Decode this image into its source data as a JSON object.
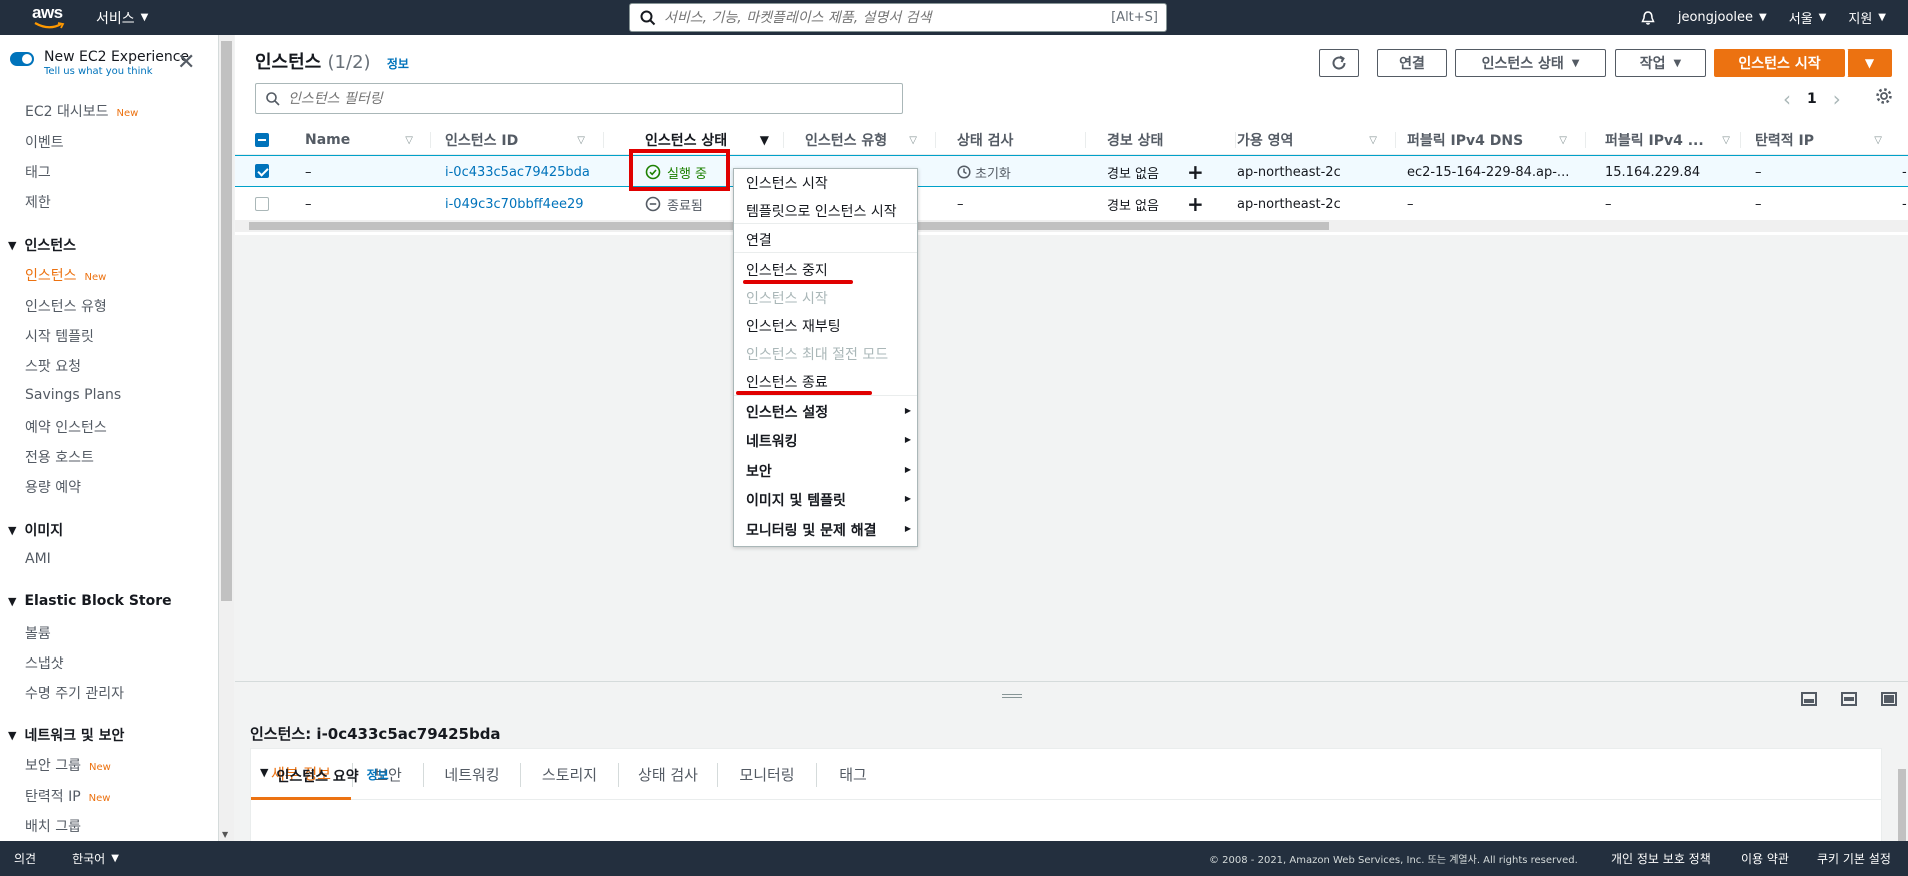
{
  "topnav": {
    "logo": "aws",
    "services_label": "서비스",
    "search_placeholder": "서비스, 기능, 마켓플레이스 제품, 설명서 검색",
    "search_shortcut": "[Alt+S]",
    "user": "jeongjoolee",
    "region": "서울",
    "support": "지원"
  },
  "sidebar": {
    "experience_title": "New EC2 Experience",
    "experience_sub": "Tell us what you think",
    "items_top": [
      "EC2 대시보드",
      "이벤트",
      "태그",
      "제한"
    ],
    "new_badge": "New",
    "section_instances": "인스턴스",
    "items_instances": [
      "인스턴스",
      "인스턴스 유형",
      "시작 템플릿",
      "스팟 요청",
      "Savings Plans",
      "예약 인스턴스",
      "전용 호스트",
      "용량 예약"
    ],
    "section_images": "이미지",
    "items_images": [
      "AMI"
    ],
    "section_ebs": "Elastic Block Store",
    "items_ebs": [
      "볼륨",
      "스냅샷",
      "수명 주기 관리자"
    ],
    "section_network": "네트워크 및 보안",
    "items_network": [
      "보안 그룹",
      "탄력적 IP",
      "배치 그룹"
    ]
  },
  "main": {
    "title": "인스턴스",
    "count": "(1/2)",
    "info": "정보",
    "btn_connect": "연결",
    "btn_state": "인스턴스 상태",
    "btn_actions": "작업",
    "btn_launch": "인스턴스 시작",
    "filter_placeholder": "인스턴스 필터링",
    "page": "1"
  },
  "table": {
    "columns": [
      "Name",
      "인스턴스 ID",
      "인스턴스 상태",
      "인스턴스 유형",
      "상태 검사",
      "경보 상태",
      "가용 영역",
      "퍼블릭 IPv4 DNS",
      "퍼블릭 IPv4 ...",
      "탄력적 IP"
    ],
    "rows": [
      {
        "name": "–",
        "id": "i-0c433c5ac79425bda",
        "state": "실행 중",
        "type": "",
        "check": "초기화",
        "alarm": "경보 없음",
        "az": "ap-northeast-2c",
        "dns": "ec2-15-164-229-84.ap-...",
        "ip": "15.164.229.84",
        "eip": "–",
        "extra": "-"
      },
      {
        "name": "–",
        "id": "i-049c3c70bbff4ee29",
        "state": "종료됨",
        "type": "",
        "check": "–",
        "alarm": "경보 없음",
        "az": "ap-northeast-2c",
        "dns": "–",
        "ip": "–",
        "eip": "–",
        "extra": "-"
      }
    ]
  },
  "context_menu": {
    "items": [
      "인스턴스 시작",
      "템플릿으로 인스턴스 시작",
      "연결",
      "인스턴스 중지",
      "인스턴스 시작",
      "인스턴스 재부팅",
      "인스턴스 최대 절전 모드",
      "인스턴스 종료",
      "인스턴스 설정",
      "네트워킹",
      "보안",
      "이미지 및 템플릿",
      "모니터링 및 문제 해결"
    ]
  },
  "detail": {
    "title": "인스턴스: i-0c433c5ac79425bda",
    "tabs": [
      "세부 정보",
      "보안",
      "네트워킹",
      "스토리지",
      "상태 검사",
      "모니터링",
      "태그"
    ],
    "summary": "인스턴스 요약",
    "summary_info": "정보"
  },
  "footer": {
    "feedback": "의견",
    "language": "한국어",
    "copyright": "© 2008 - 2021, Amazon Web Services, Inc. 또는 계열사. All rights reserved.",
    "privacy": "개인 정보 보호 정책",
    "terms": "이용 약관",
    "cookies": "쿠키 기본 설정"
  },
  "colors": {
    "nav_bg": "#232f3e",
    "accent_orange": "#ec7211",
    "link_blue": "#0073bb",
    "running_green": "#1d8102",
    "highlight_red": "#e00000"
  }
}
